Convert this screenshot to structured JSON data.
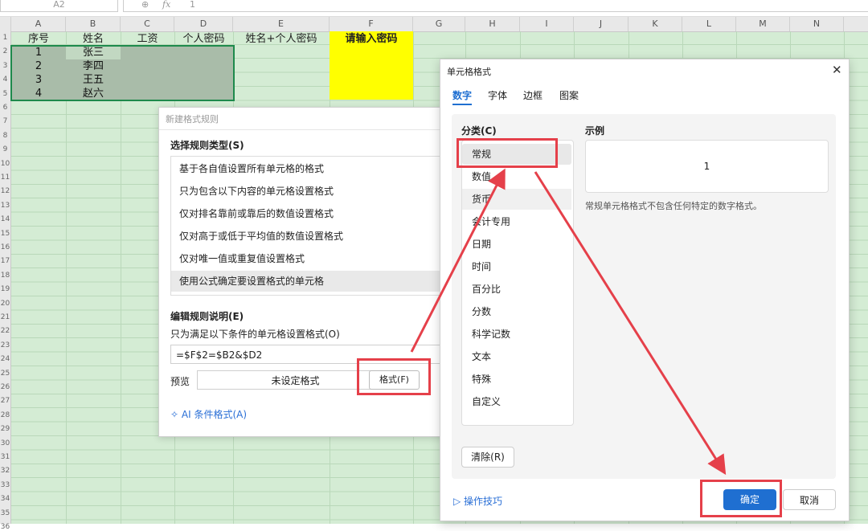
{
  "formula_bar": {
    "name_box": "A2",
    "zoom_icon": "zoom-icon",
    "fx_label": "fx",
    "value": "1"
  },
  "columns": [
    "A",
    "B",
    "C",
    "D",
    "E",
    "F",
    "G",
    "H",
    "I",
    "J",
    "K",
    "L",
    "M",
    "N"
  ],
  "row_numbers": [
    "1",
    "2",
    "3",
    "4",
    "5",
    "6",
    "7",
    "8",
    "9",
    "10",
    "11",
    "12",
    "13",
    "14",
    "15",
    "16",
    "17",
    "18",
    "19",
    "20",
    "21",
    "22",
    "23",
    "24",
    "25",
    "26",
    "27",
    "28",
    "29",
    "30",
    "31",
    "32",
    "33",
    "34",
    "35",
    "36"
  ],
  "table": {
    "headers": {
      "a": "序号",
      "b": "姓名",
      "c": "工资",
      "d": "个人密码",
      "e": "姓名+个人密码",
      "f": "请输入密码"
    },
    "rows": [
      {
        "no": "1",
        "name": "张三"
      },
      {
        "no": "2",
        "name": "李四"
      },
      {
        "no": "3",
        "name": "王五"
      },
      {
        "no": "4",
        "name": "赵六"
      }
    ]
  },
  "new_rule_dialog": {
    "title": "新建格式规则",
    "select_type_label": "选择规则类型(S)",
    "rule_types": [
      "基于各自值设置所有单元格的格式",
      "只为包含以下内容的单元格设置格式",
      "仅对排名靠前或靠后的数值设置格式",
      "仅对高于或低于平均值的数值设置格式",
      "仅对唯一值或重复值设置格式",
      "使用公式确定要设置格式的单元格"
    ],
    "edit_desc_label": "编辑规则说明(E)",
    "condition_label": "只为满足以下条件的单元格设置格式(O)",
    "formula": "=$F$2=$B2&$D2",
    "preview_label": "预览",
    "preview_value": "未设定格式",
    "format_button": "格式(F)",
    "ai_link": "AI 条件格式(A)"
  },
  "cell_format_dialog": {
    "title": "单元格格式",
    "tabs": [
      "数字",
      "字体",
      "边框",
      "图案"
    ],
    "category_label": "分类(C)",
    "categories": [
      "常规",
      "数值",
      "货币",
      "会计专用",
      "日期",
      "时间",
      "百分比",
      "分数",
      "科学记数",
      "文本",
      "特殊",
      "自定义"
    ],
    "sample_label": "示例",
    "sample_value": "1",
    "description": "常规单元格格式不包含任何特定的数字格式。",
    "clear_button": "清除(R)",
    "tips_link": "操作技巧",
    "ok_button": "确定",
    "cancel_button": "取消"
  },
  "colors": {
    "sheet_bg": "#d4ecd4",
    "selection": "#1e8a4c",
    "highlight_yellow": "#ffff00",
    "annotation_red": "#e5404a",
    "primary_blue": "#1f6fd1"
  }
}
